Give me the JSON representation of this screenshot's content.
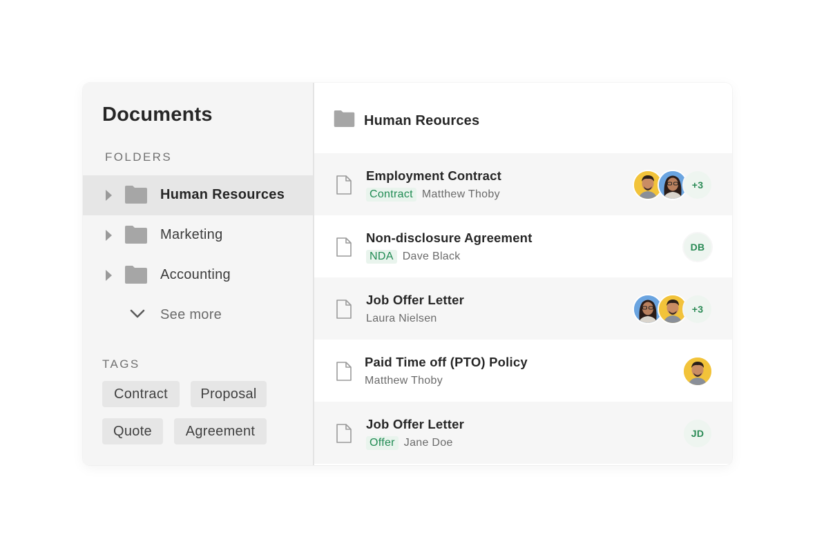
{
  "sidebar": {
    "title": "Documents",
    "folders_label": "FOLDERS",
    "folders": [
      {
        "label": "Human Resources",
        "active": true
      },
      {
        "label": "Marketing",
        "active": false
      },
      {
        "label": "Accounting",
        "active": false
      }
    ],
    "see_more": "See more",
    "tags_label": "TAGS",
    "tags": [
      "Contract",
      "Proposal",
      "Quote",
      "Agreement"
    ]
  },
  "main": {
    "folder_title": "Human Reources",
    "documents": [
      {
        "title": "Employment Contract",
        "badge": "Contract",
        "owner": "Matthew Thoby",
        "avatars": [
          "man-photo",
          "woman-photo"
        ],
        "extra": "+3"
      },
      {
        "title": "Non-disclosure Agreement",
        "badge": "NDA",
        "owner": "Dave Black",
        "initials": "DB"
      },
      {
        "title": "Job Offer Letter",
        "owner": "Laura Nielsen",
        "avatars": [
          "woman-photo",
          "man-photo"
        ],
        "extra": "+3"
      },
      {
        "title": "Paid Time off (PTO) Policy",
        "owner": "Matthew Thoby",
        "avatars": [
          "man-photo"
        ]
      },
      {
        "title": "Job Offer Letter",
        "badge": "Offer",
        "owner": "Jane Doe",
        "initials": "JD"
      }
    ]
  },
  "colors": {
    "badge_bg": "#e9f4ed",
    "badge_text": "#1f8a52",
    "sidebar_bg": "#f5f5f5",
    "active_row": "#e6e6e6",
    "folder_icon": "#a6a6a6"
  },
  "icons": {
    "folder": "folder-icon",
    "file": "file-icon",
    "caret": "caret-right-icon",
    "chevron": "chevron-down-icon"
  }
}
